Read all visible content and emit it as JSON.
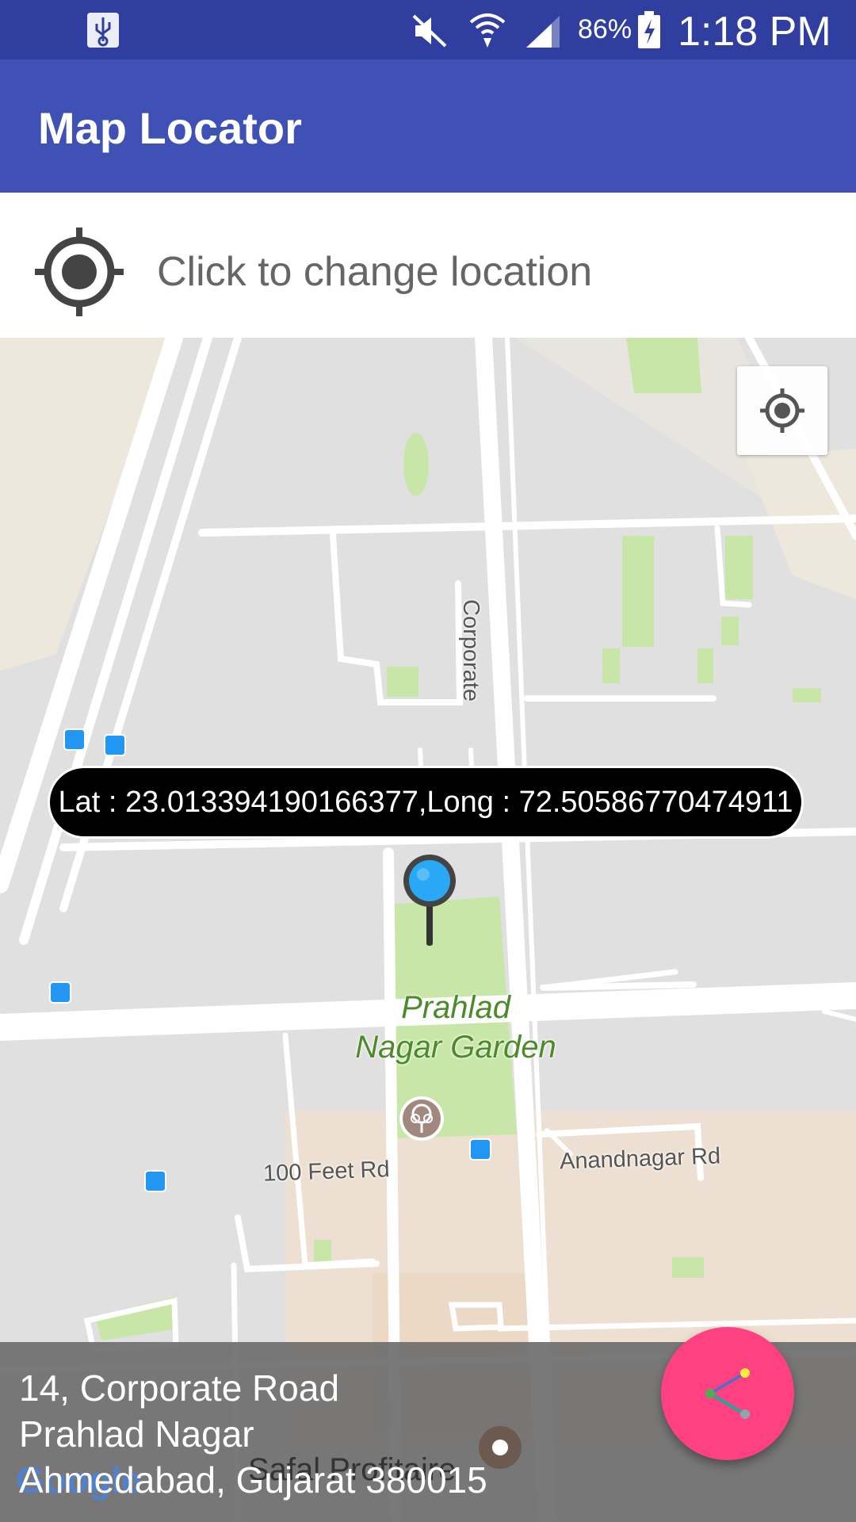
{
  "status_bar": {
    "battery_percent": "86%",
    "time": "1:18 PM",
    "icons": [
      "usb-icon",
      "mute-icon",
      "wifi-icon",
      "signal-icon",
      "battery-charging-icon"
    ]
  },
  "app_bar": {
    "title": "Map Locator"
  },
  "location_row": {
    "label": "Click to change location",
    "icon": "gps-target-icon"
  },
  "map": {
    "coordinates_text": "Lat : 23.013394190166377,Long : 72.50586770474911",
    "poi_label_line1": "Prahlad",
    "poi_label_line2": "Nagar Garden",
    "road_corporate": "Corporate",
    "road_100feet": "100 Feet Rd",
    "road_anandnagar": "Anandnagar Rd",
    "place_safal": "Safal Profitaire",
    "watermark": "Google",
    "colors": {
      "park": "#C8E6A8",
      "road": "#FFFFFF",
      "block": "#E0E0E0",
      "sand": "#EDE7DC"
    }
  },
  "address": {
    "line1": "14, Corporate Road",
    "line2": "Prahlad Nagar",
    "line3": "Ahmedabad, Gujarat 380015"
  },
  "fab": {
    "icon": "share-icon",
    "color": "#FF4081"
  },
  "theme": {
    "primary": "#3F51B5",
    "primary_dark": "#303F9F"
  }
}
